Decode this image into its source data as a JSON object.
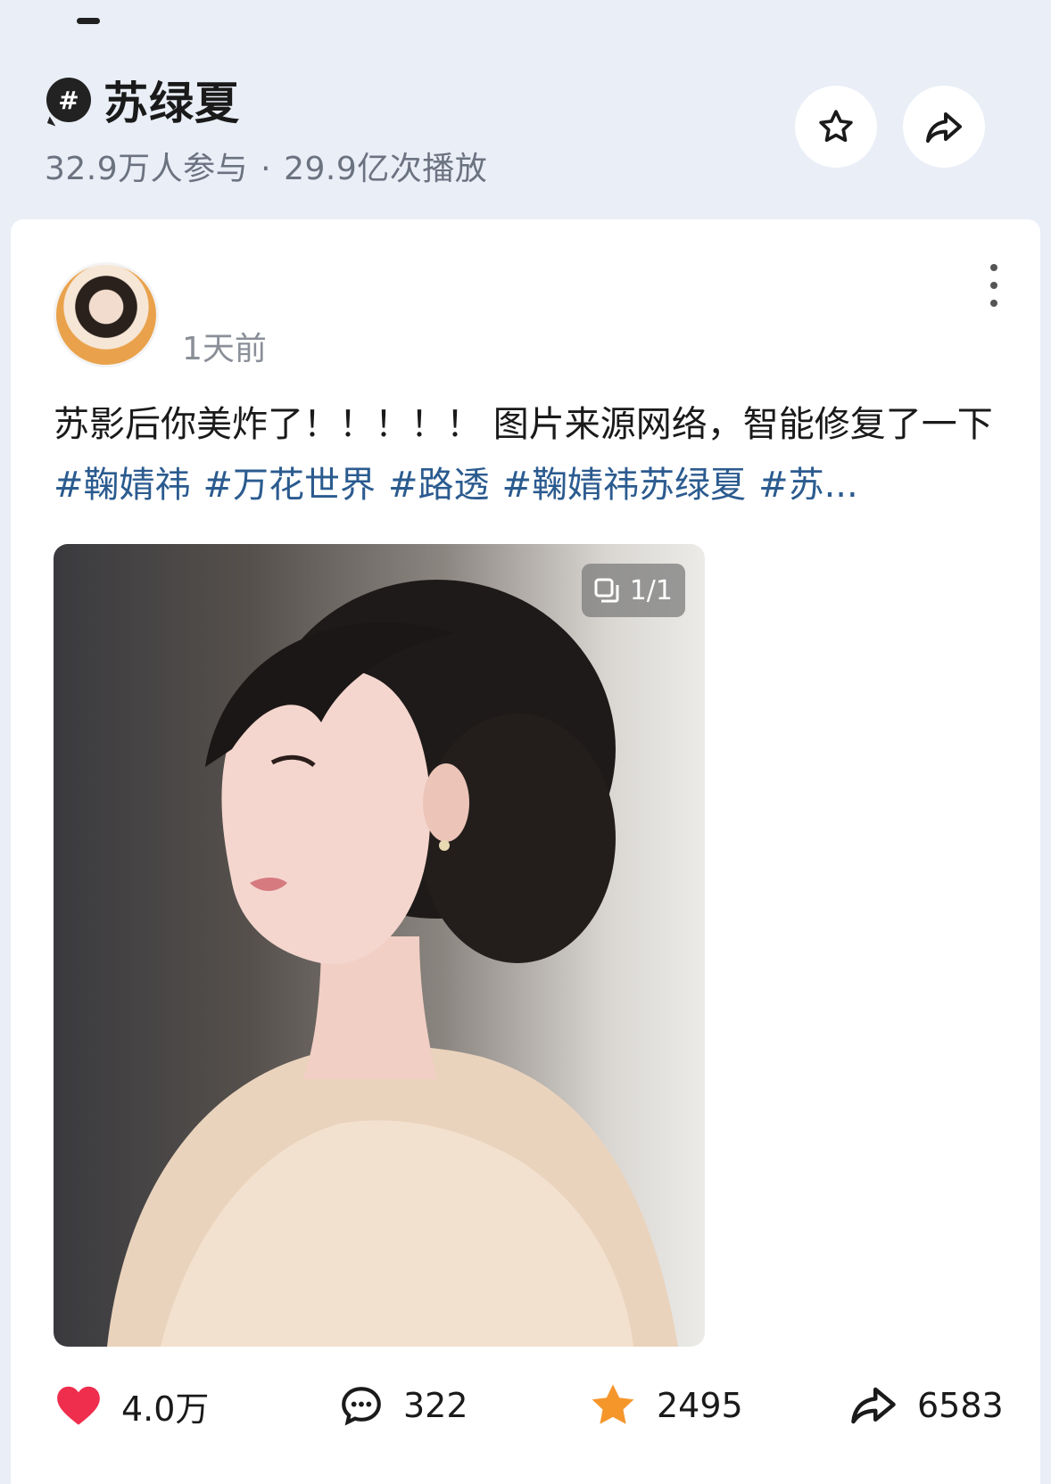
{
  "topic": {
    "name": "苏绿夏",
    "participants": "32.9万人参与",
    "separator": "·",
    "plays": "29.9亿次播放"
  },
  "post": {
    "time": "1天前",
    "text": "苏影后你美炸了！！！！！ 图片来源网络，智能修复了一下",
    "tags": [
      "#鞠婧祎",
      "#万花世界",
      "#路透",
      "#鞠婧祎苏绿夏",
      "#苏..."
    ],
    "image_count": "1/1"
  },
  "actions": {
    "likes": "4.0万",
    "comments": "322",
    "favorites": "2495",
    "shares": "6583"
  },
  "colors": {
    "background": "#e9eef7",
    "like": "#ef2d4d",
    "favorite": "#f5962b",
    "tag": "#2b5b8f"
  },
  "icons": [
    "hash-icon",
    "star-outline-icon",
    "share-icon",
    "more-icon",
    "pages-icon",
    "heart-icon",
    "comment-icon",
    "star-filled-icon",
    "forward-icon"
  ]
}
